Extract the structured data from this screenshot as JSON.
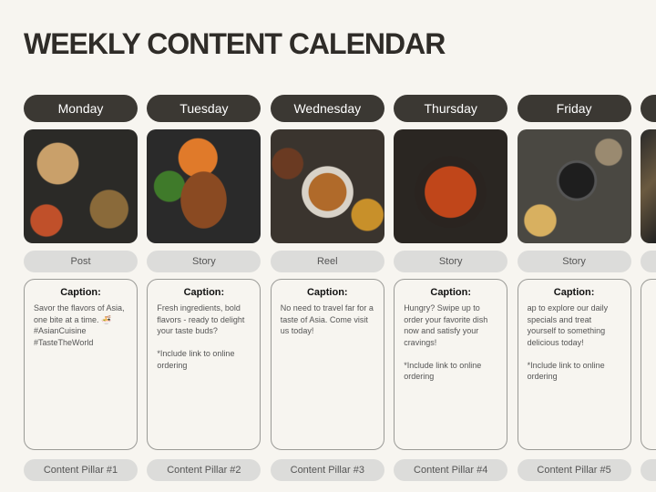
{
  "title": "WEEKLY CONTENT CALENDAR",
  "caption_label": "Caption:",
  "days": [
    {
      "day": "Monday",
      "type": "Post",
      "caption": "Savor the flavors of Asia, one bite at a time. 🍜\n#AsianCuisine\n#TasteTheWorld",
      "pillar": "Content Pillar #1",
      "image": "asian-dishes-spread"
    },
    {
      "day": "Tuesday",
      "type": "Story",
      "caption": "Fresh ingredients, bold flavors - ready to delight your taste buds?\n\n*Include link to online ordering",
      "pillar": "Content Pillar #2",
      "image": "grilled-meat-salad"
    },
    {
      "day": "Wednesday",
      "type": "Reel",
      "caption": "No need to travel far for a taste of Asia. Come visit us today!",
      "pillar": "Content Pillar #3",
      "image": "roast-chicken-table"
    },
    {
      "day": "Thursday",
      "type": "Story",
      "caption": "Hungry? Swipe up to order your favorite dish now and satisfy your cravings!\n\n*Include link to online ordering",
      "pillar": "Content Pillar #4",
      "image": "sweet-sour-chicken-wok"
    },
    {
      "day": "Friday",
      "type": "Story",
      "caption": "ap to explore our daily specials and treat yourself to something delicious today!\n\n*Include link to online ordering",
      "pillar": "Content Pillar #5",
      "image": "wok-ingredients"
    }
  ],
  "colors": {
    "day_pill": "#3b3833",
    "pill": "#dcdcda",
    "background": "#f7f5f0"
  }
}
